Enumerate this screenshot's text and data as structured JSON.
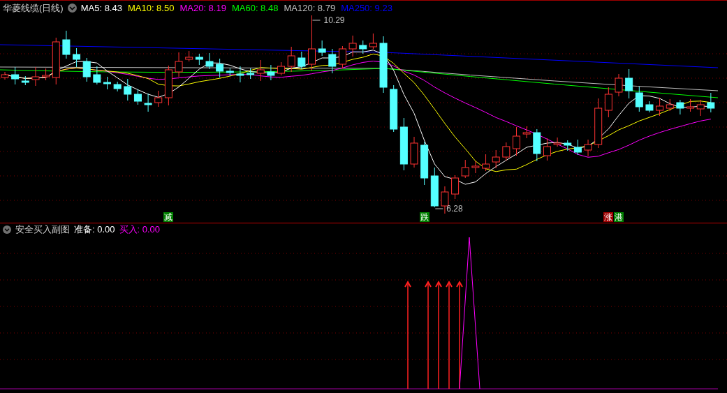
{
  "main_chart": {
    "title": "华菱线缆(日线)",
    "ma_legend": [
      {
        "label": "MA5: 8.43",
        "color": "#ffffff"
      },
      {
        "label": "MA10: 8.50",
        "color": "#ffff00"
      },
      {
        "label": "MA20: 8.19",
        "color": "#ff00ff"
      },
      {
        "label": "MA60: 8.48",
        "color": "#00ff00"
      },
      {
        "label": "MA120: 8.79",
        "color": "#c0c0c0"
      },
      {
        "label": "MA250: 9.23",
        "color": "#0000ff"
      }
    ],
    "price_labels": [
      {
        "kind": "high",
        "text": "10.29"
      },
      {
        "kind": "low",
        "text": "6.28"
      }
    ],
    "event_markers": [
      {
        "text": "减",
        "color": "#008000"
      },
      {
        "text": "跌",
        "color": "#008000"
      },
      {
        "text": "涨",
        "color": "#a00000"
      },
      {
        "text": "港",
        "color": "#008000"
      }
    ]
  },
  "sub_chart": {
    "title": "安全买入副图",
    "legend": [
      {
        "label": "准备: 0.00",
        "color": "#ffffff"
      },
      {
        "label": "买入: 0.00",
        "color": "#ff00ff"
      }
    ]
  }
}
